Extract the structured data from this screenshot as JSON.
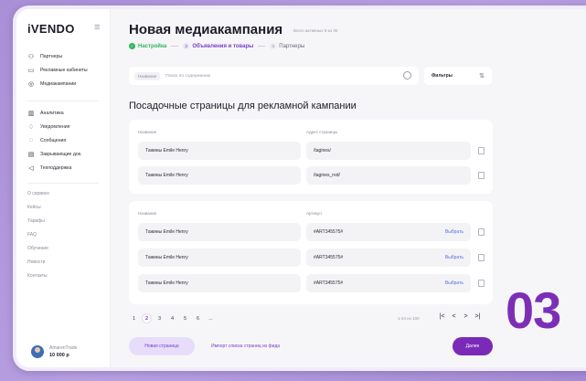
{
  "sidebar": {
    "logo": "iVENDO",
    "group1": [
      "Партнеры",
      "Рекламные кабинеты",
      "Медиакампании"
    ],
    "group2": [
      "Аналитика",
      "Уведомления",
      "Сообщения",
      "Закрывающие док.",
      "Техподдержка"
    ],
    "links": [
      "О сервисе",
      "Кейсы",
      "Тарифы",
      "FAQ",
      "Обучение",
      "Новости",
      "Контакты"
    ],
    "user": {
      "name": "AmarenTrade",
      "balance": "10 000 р"
    }
  },
  "header": {
    "title": "Новая медиакампания",
    "subtitle": "Всего активных 9 из 30",
    "steps": [
      {
        "num": "✓",
        "label": "Настройка",
        "state": "done"
      },
      {
        "num": "2",
        "label": "Объявления и товары",
        "state": "active"
      },
      {
        "num": "3",
        "label": "Партнеры",
        "state": "idle"
      }
    ]
  },
  "search": {
    "chip": "Название",
    "placeholder": "Поиск по содержанию"
  },
  "filter": {
    "label": "Фильтры"
  },
  "section_title": "Посадочные страницы для рекламной кампании",
  "landing_pages": {
    "col_name": "Название",
    "col_url": "Адрес страницы",
    "rows": [
      {
        "name": "Тажины Emile Henry",
        "url": "/tagines/"
      },
      {
        "name": "Тажины Emile Henry",
        "url": "/tagines_red/"
      }
    ]
  },
  "products": {
    "col_name": "Название",
    "col_sku": "Артикул",
    "pick_label": "Выбрать",
    "rows": [
      {
        "name": "Тажины Emile Henry",
        "sku": "#ART345575#"
      },
      {
        "name": "Тажины Emile Henry",
        "sku": "#ART345575#"
      },
      {
        "name": "Тажины Emile Henry",
        "sku": "#ART345575#"
      }
    ]
  },
  "pager": {
    "pages": [
      "1",
      "2",
      "3",
      "4",
      "5",
      "6",
      "..."
    ],
    "active": "2",
    "range": "1-24 из 100",
    "arrows": [
      "|<",
      "<",
      ">",
      ">|"
    ]
  },
  "footer": {
    "new_page": "Новая страница",
    "import": "Импорт списка страниц из фида",
    "next": "Далее"
  },
  "overlay_number": "03",
  "colors": {
    "accent": "#7b2ab8",
    "success": "#2fb65e",
    "link": "#5a6ee0"
  }
}
